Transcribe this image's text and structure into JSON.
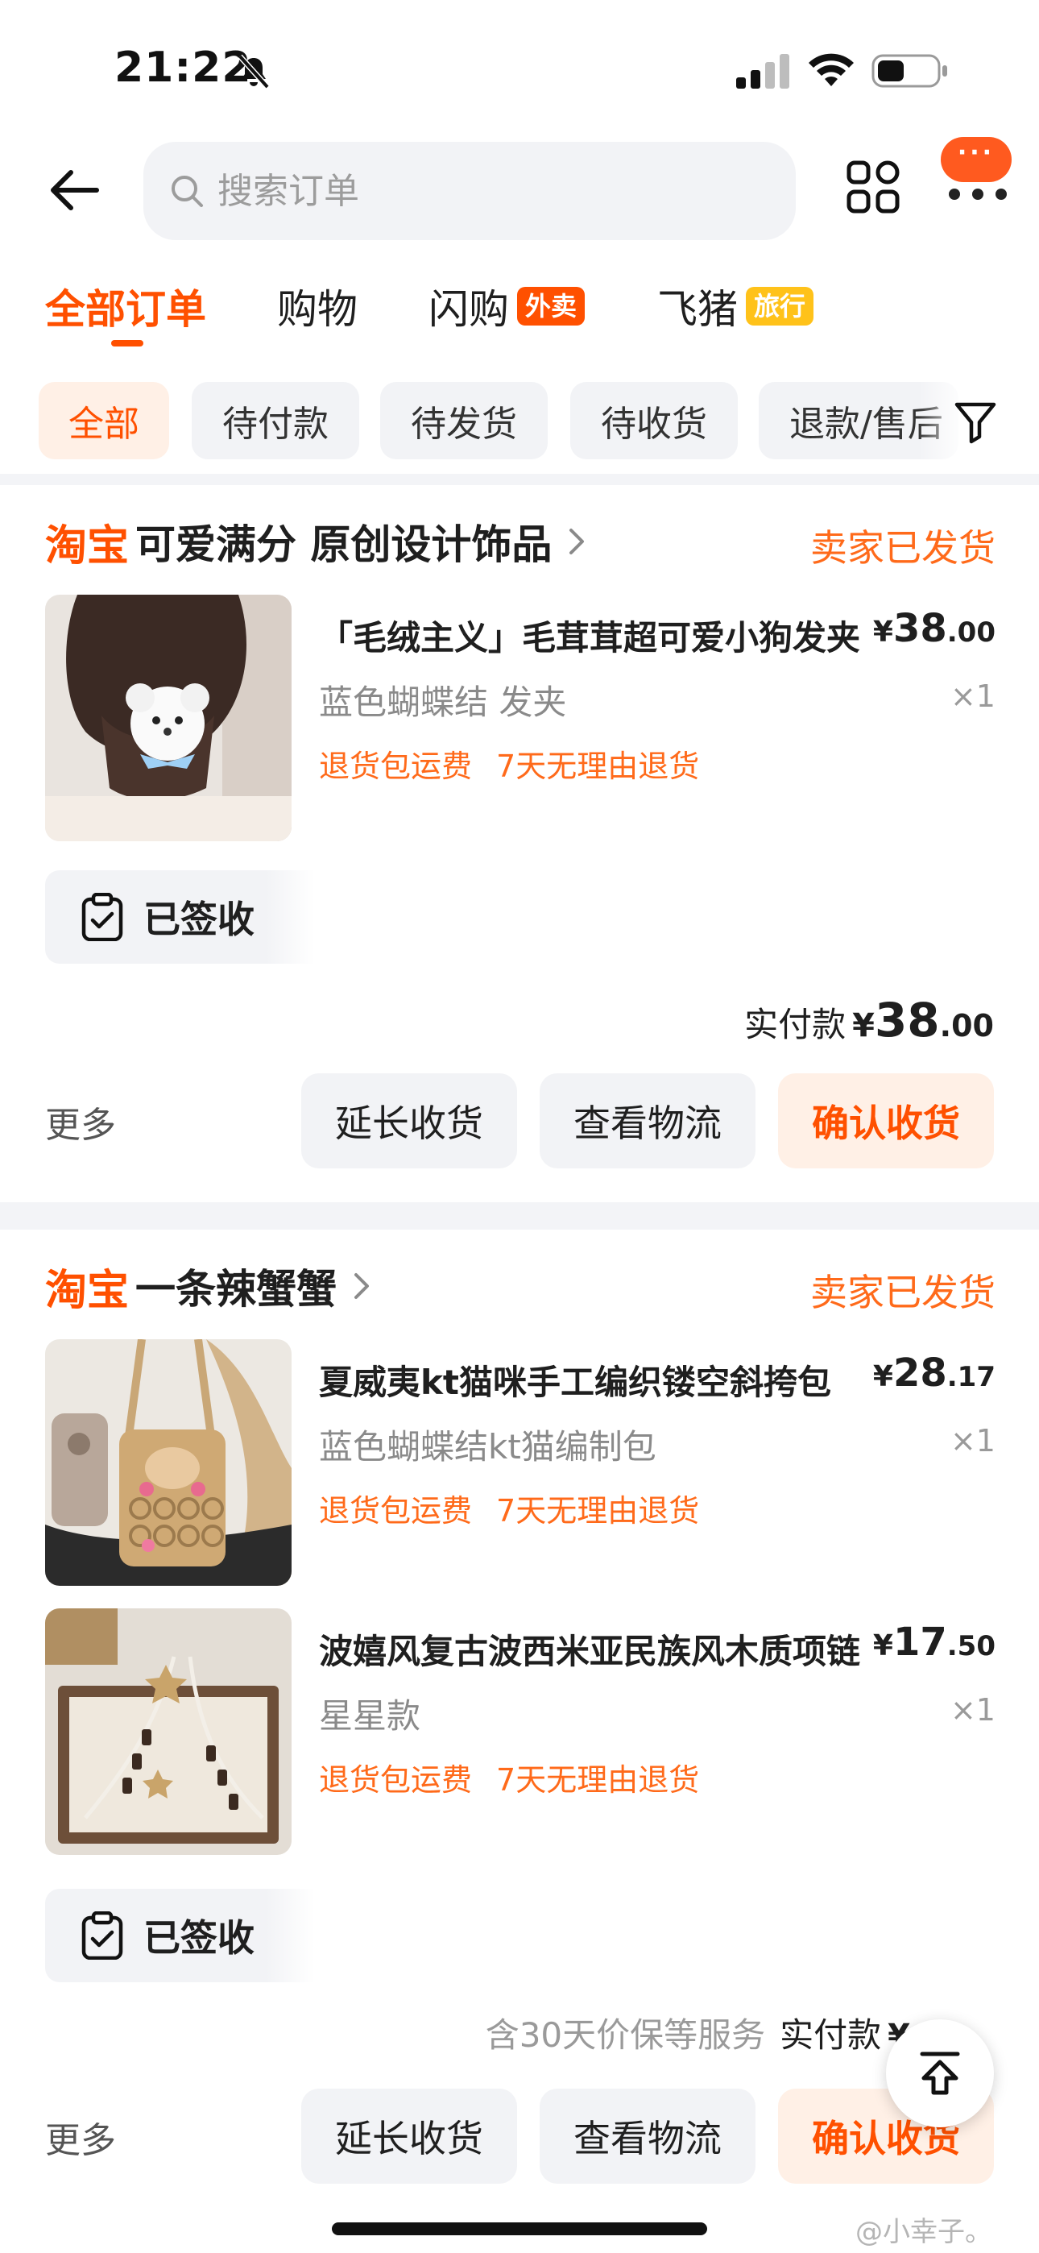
{
  "status_bar": {
    "time": "21:22"
  },
  "header": {
    "search_placeholder": "搜索订单",
    "more_bubble": "···"
  },
  "main_tabs": [
    {
      "label": "全部订单"
    },
    {
      "label": "购物"
    },
    {
      "label": "闪购",
      "tag": "外卖"
    },
    {
      "label": "飞猪",
      "tag": "旅行"
    }
  ],
  "filters": [
    "全部",
    "待付款",
    "待发货",
    "待收货",
    "退款/售后"
  ],
  "orders": [
    {
      "shop_logo": "淘宝",
      "shop_name": "可爱满分 原创设计饰品",
      "status": "卖家已发货",
      "items": [
        {
          "title": "「毛绒主义」毛茸茸超可爱小狗发夹",
          "price_currency": "¥",
          "price_int": "38",
          "price_dec": ".00",
          "spec": "蓝色蝴蝶结 发夹",
          "qty": "×1",
          "tags": [
            "退货包运费",
            "7天无理由退货"
          ]
        }
      ],
      "signed_label": "已签收",
      "pay_label": "实付款",
      "pay_currency": "¥",
      "pay_int": "38",
      "pay_dec": ".00",
      "more_label": "更多",
      "actions": [
        "延长收货",
        "查看物流",
        "确认收货"
      ]
    },
    {
      "shop_logo": "淘宝",
      "shop_name": "一条辣蟹蟹",
      "status": "卖家已发货",
      "items": [
        {
          "title": "夏威夷kt猫咪手工编织镂空斜挎包",
          "price_currency": "¥",
          "price_int": "28",
          "price_dec": ".17",
          "spec": "蓝色蝴蝶结kt猫编制包",
          "qty": "×1",
          "tags": [
            "退货包运费",
            "7天无理由退货"
          ]
        },
        {
          "title": "波嬉风复古波西米亚民族风木质项链",
          "price_currency": "¥",
          "price_int": "17",
          "price_dec": ".50",
          "spec": "星星款",
          "qty": "×1",
          "tags": [
            "退货包运费",
            "7天无理由退货"
          ]
        }
      ],
      "signed_label": "已签收",
      "pay_note": "含30天价保等服务",
      "pay_label": "实付款",
      "pay_currency": "¥",
      "more_label": "更多",
      "actions": [
        "延长收货",
        "查看物流",
        "确认收货"
      ]
    }
  ],
  "watermark": "@小幸子。",
  "colors": {
    "accent": "#ff5000",
    "status": "#ff6a1a",
    "chip_bg": "#f2f3f6",
    "primary_btn_bg": "#fff0e6"
  }
}
